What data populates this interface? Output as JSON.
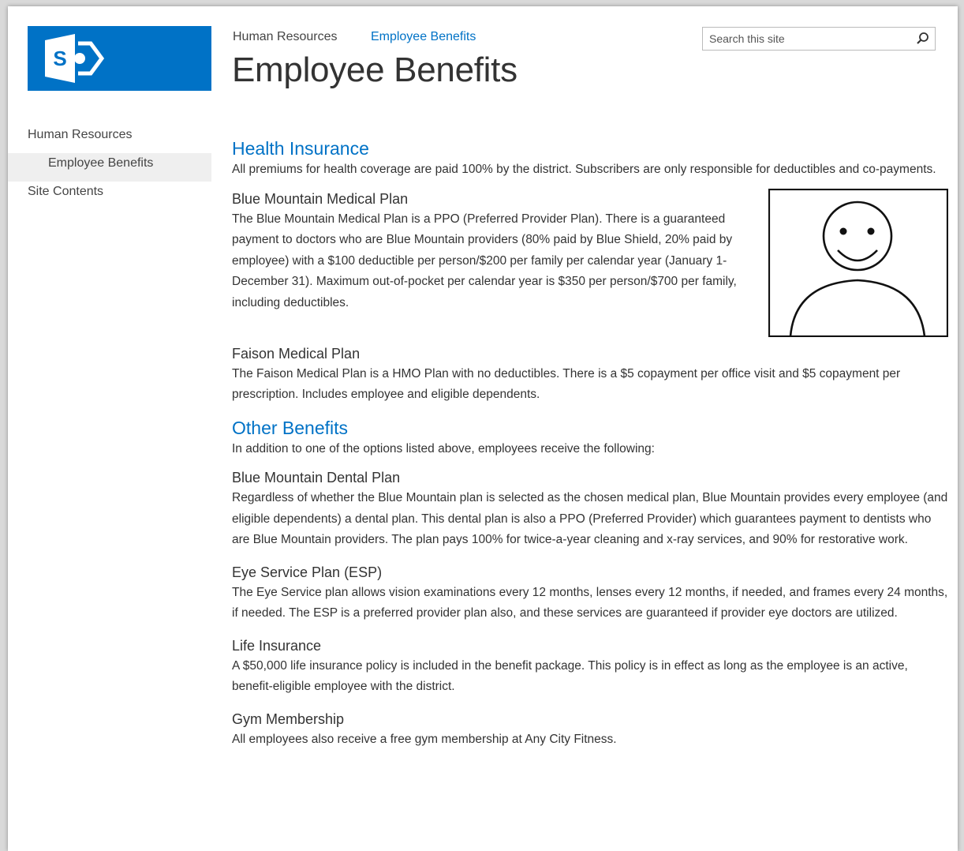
{
  "logo": {
    "letter": "S"
  },
  "breadcrumb": {
    "parent": "Human Resources",
    "current": "Employee Benefits"
  },
  "page_title": "Employee Benefits",
  "search": {
    "placeholder": "Search this site"
  },
  "left_nav": {
    "items": [
      {
        "label": "Human Resources"
      },
      {
        "label": "Employee Benefits"
      },
      {
        "label": "Site Contents"
      }
    ]
  },
  "sections": [
    {
      "heading": "Health Insurance",
      "intro": "All premiums for health coverage are paid 100% by the district. Subscribers are only responsible for deductibles and co-payments.",
      "subsections": [
        {
          "title": "Blue Mountain Medical Plan",
          "text": "The Blue Mountain Medical Plan is a PPO (Preferred Provider Plan). There is a guaranteed payment to doctors who are Blue Mountain providers (80% paid by Blue Shield, 20% paid by employee) with a $100 deductible per person/$200 per family per calendar year (January 1-December 31). Maximum out-of-pocket per calendar year is $350 per person/$700 per family, including deductibles."
        },
        {
          "title": "Faison Medical Plan",
          "text": "The Faison Medical Plan is a HMO Plan with no deductibles. There is a $5 copayment per office visit and $5 copayment per prescription. Includes employee and eligible dependents."
        }
      ]
    },
    {
      "heading": "Other Benefits",
      "intro": "In addition to one of the options listed above, employees receive the following:",
      "subsections": [
        {
          "title": "Blue Mountain Dental Plan",
          "text": "Regardless of whether the Blue Mountain plan is selected as the chosen medical plan, Blue Mountain provides every employee (and eligible dependents) a dental plan. This dental plan is also a PPO (Preferred Provider) which guarantees payment to dentists who are Blue Mountain providers. The plan pays 100% for twice-a-year cleaning and x-ray services, and 90% for restorative work."
        },
        {
          "title": "Eye Service Plan (ESP)",
          "text": "The Eye Service plan allows vision examinations every 12 months, lenses every 12 months, if needed, and frames every 24 months, if needed. The ESP is a preferred provider plan also, and these services are guaranteed if provider eye doctors are utilized."
        },
        {
          "title": "Life Insurance",
          "text": "A $50,000 life insurance policy is included in the benefit package. This policy is in effect as long as the employee is an active, benefit-eligible employee with the district."
        },
        {
          "title": "Gym Membership",
          "text": "All employees also receive a free gym membership at Any City Fitness."
        }
      ]
    }
  ],
  "colors": {
    "accent": "#0072c6",
    "nav_selected_bg": "#efefef"
  }
}
